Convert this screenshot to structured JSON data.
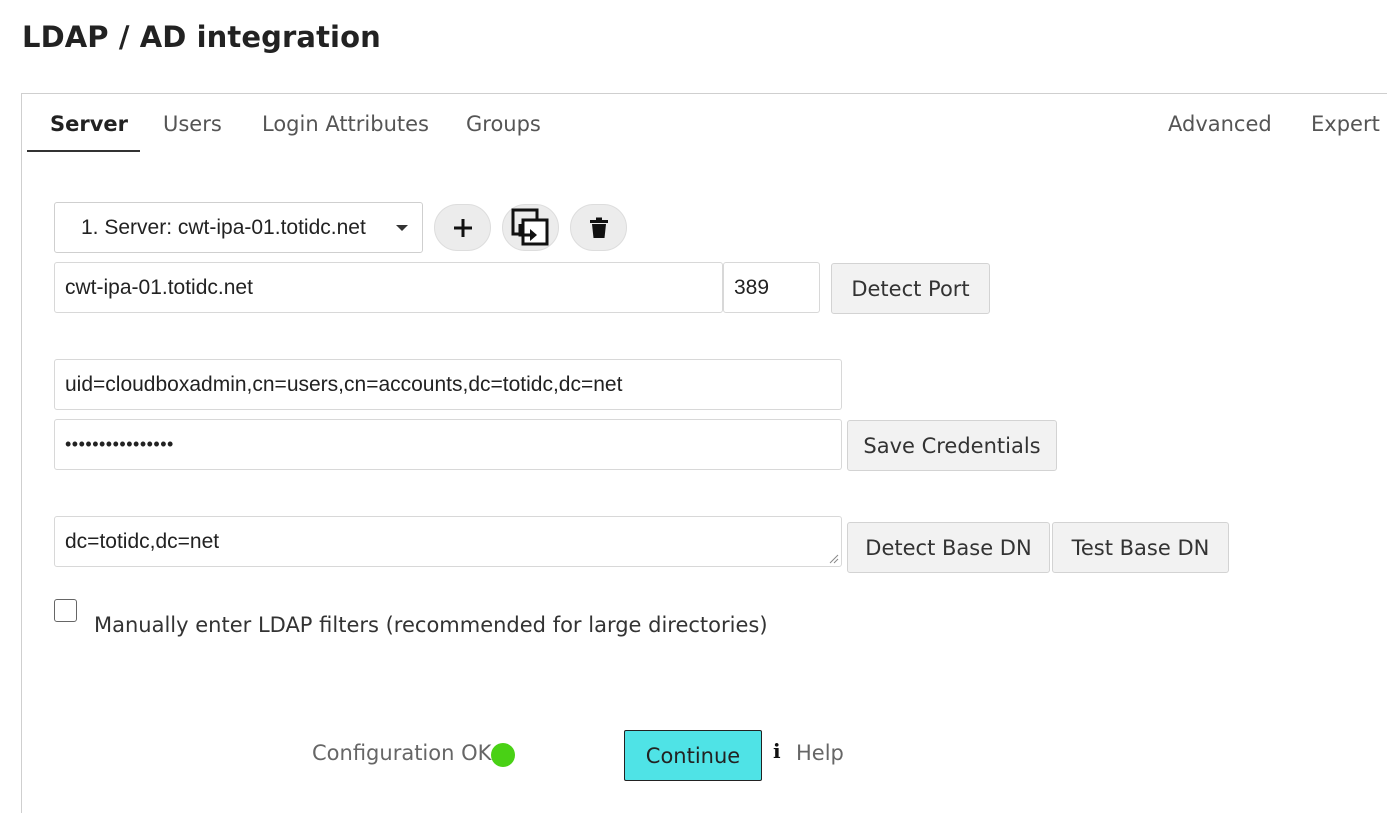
{
  "page": {
    "title": "LDAP / AD integration"
  },
  "tabs": [
    {
      "label": "Server",
      "active": true
    },
    {
      "label": "Users"
    },
    {
      "label": "Login Attributes"
    },
    {
      "label": "Groups"
    },
    {
      "label": "Advanced"
    },
    {
      "label": "Expert"
    }
  ],
  "server": {
    "selected": "1. Server: cwt-ipa-01.totidc.net",
    "add_icon": "plus-icon",
    "copy_icon": "copy-config-icon",
    "delete_icon": "trash-icon"
  },
  "connection": {
    "host": "cwt-ipa-01.totidc.net",
    "port": "389",
    "detect_port_label": "Detect Port"
  },
  "credentials": {
    "user_dn": "uid=cloudboxadmin,cn=users,cn=accounts,dc=totidc,dc=net",
    "password_masked": "••••••••••••••••",
    "save_label": "Save Credentials"
  },
  "base_dn": {
    "value": "dc=totidc,dc=net",
    "detect_label": "Detect Base DN",
    "test_label": "Test Base DN"
  },
  "manual_filters": {
    "label": "Manually enter LDAP filters (recommended for large directories)",
    "checked": false
  },
  "footer": {
    "status_text": "Configuration OK",
    "status_color": "#49d115",
    "continue_label": "Continue",
    "help_label": "Help",
    "info_icon": "info-icon"
  },
  "colors": {
    "accent": "#4fe3e6"
  }
}
